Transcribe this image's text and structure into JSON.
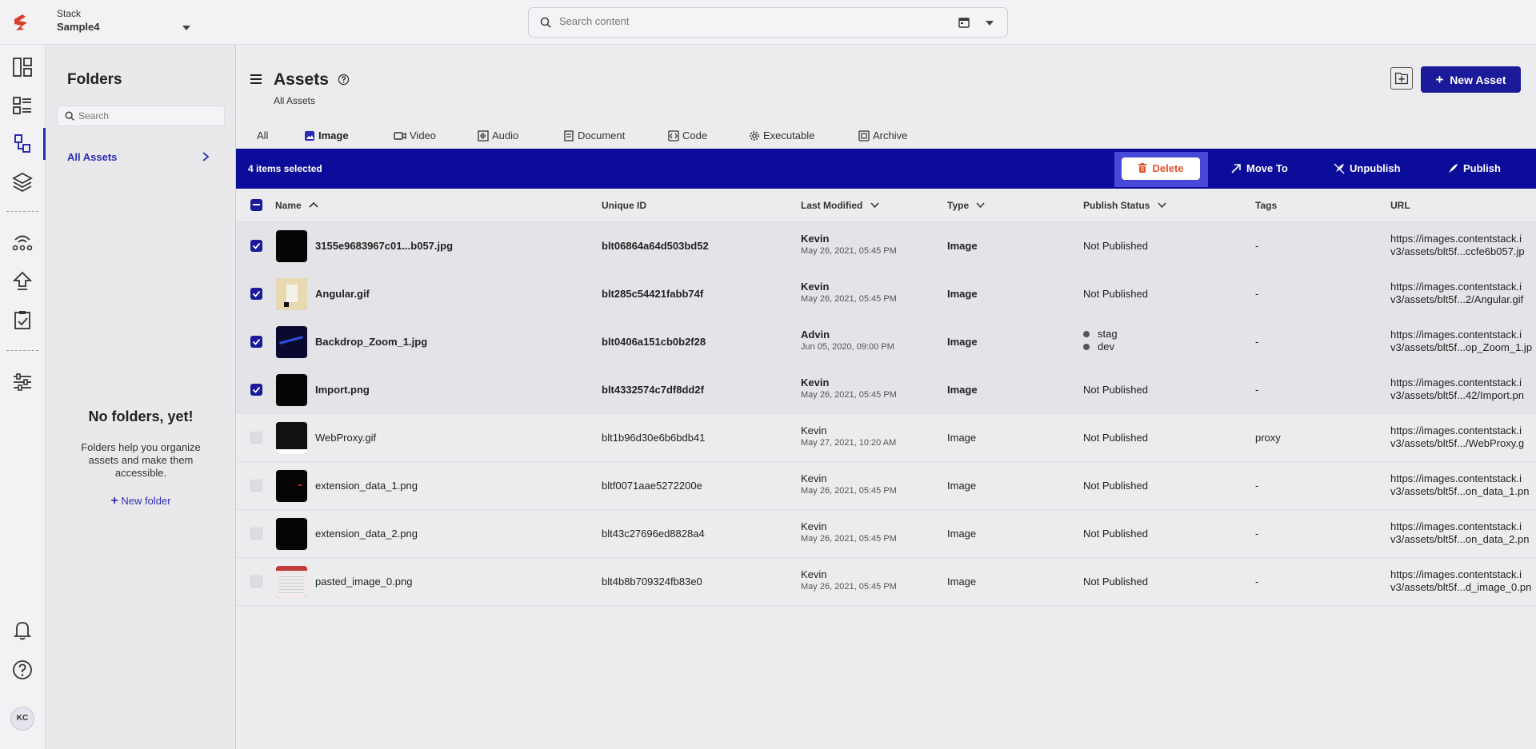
{
  "app": {
    "stack_label": "Stack",
    "stack_name": "Sample4",
    "search_placeholder": "Search content",
    "avatar_initials": "KC"
  },
  "folders": {
    "title": "Folders",
    "search_placeholder": "Search",
    "all_assets": "All Assets",
    "empty_title": "No folders, yet!",
    "empty_desc": "Folders help you organize assets and make them accessible.",
    "new_folder": "New folder"
  },
  "header": {
    "title": "Assets",
    "breadcrumb": "All Assets",
    "new_asset": "New Asset"
  },
  "tabs": [
    {
      "label": "All",
      "icon": "none"
    },
    {
      "label": "Image",
      "icon": "image-icon",
      "active": true
    },
    {
      "label": "Video",
      "icon": "video-icon"
    },
    {
      "label": "Audio",
      "icon": "audio-icon"
    },
    {
      "label": "Document",
      "icon": "document-icon"
    },
    {
      "label": "Code",
      "icon": "code-icon"
    },
    {
      "label": "Executable",
      "icon": "gear-icon"
    },
    {
      "label": "Archive",
      "icon": "archive-icon"
    }
  ],
  "selection_bar": {
    "count": "4 items selected",
    "delete": "Delete",
    "move_to": "Move To",
    "unpublish": "Unpublish",
    "publish": "Publish"
  },
  "columns": {
    "name": "Name",
    "uid": "Unique ID",
    "modified": "Last Modified",
    "type": "Type",
    "status": "Publish Status",
    "tags": "Tags",
    "url": "URL"
  },
  "rows": [
    {
      "name": "3155e9683967c01...b057.jpg",
      "uid": "blt06864a64d503bd52",
      "by": "Kevin",
      "date": "May 26, 2021, 05:45 PM",
      "type": "Image",
      "status": "Not Published",
      "tags": "-",
      "url1": "https://images.contentstack.i",
      "url2": "v3/assets/blt5f...ccfe6b057.jp",
      "selected": true
    },
    {
      "name": "Angular.gif",
      "uid": "blt285c54421fabb74f",
      "by": "Kevin",
      "date": "May 26, 2021, 05:45 PM",
      "type": "Image",
      "status": "Not Published",
      "tags": "-",
      "url1": "https://images.contentstack.i",
      "url2": "v3/assets/blt5f...2/Angular.gif",
      "selected": true
    },
    {
      "name": "Backdrop_Zoom_1.jpg",
      "uid": "blt0406a151cb0b2f28",
      "by": "Advin",
      "date": "Jun 05, 2020, 09:00 PM",
      "type": "Image",
      "status_envs": [
        "stag",
        "dev"
      ],
      "tags": "-",
      "url1": "https://images.contentstack.i",
      "url2": "v3/assets/blt5f...op_Zoom_1.jp",
      "selected": true
    },
    {
      "name": "Import.png",
      "uid": "blt4332574c7df8dd2f",
      "by": "Kevin",
      "date": "May 26, 2021, 05:45 PM",
      "type": "Image",
      "status": "Not Published",
      "tags": "-",
      "url1": "https://images.contentstack.i",
      "url2": "v3/assets/blt5f...42/Import.pn",
      "selected": true
    },
    {
      "name": "WebProxy.gif",
      "uid": "blt1b96d30e6b6bdb41",
      "by": "Kevin",
      "date": "May 27, 2021, 10:20 AM",
      "type": "Image",
      "status": "Not Published",
      "tags": "proxy",
      "url1": "https://images.contentstack.i",
      "url2": "v3/assets/blt5f.../WebProxy.g",
      "selected": false
    },
    {
      "name": "extension_data_1.png",
      "uid": "bltf0071aae5272200e",
      "by": "Kevin",
      "date": "May 26, 2021, 05:45 PM",
      "type": "Image",
      "status": "Not Published",
      "tags": "-",
      "url1": "https://images.contentstack.i",
      "url2": "v3/assets/blt5f...on_data_1.pn",
      "selected": false
    },
    {
      "name": "extension_data_2.png",
      "uid": "blt43c27696ed8828a4",
      "by": "Kevin",
      "date": "May 26, 2021, 05:45 PM",
      "type": "Image",
      "status": "Not Published",
      "tags": "-",
      "url1": "https://images.contentstack.i",
      "url2": "v3/assets/blt5f...on_data_2.pn",
      "selected": false
    },
    {
      "name": "pasted_image_0.png",
      "uid": "blt4b8b709324fb83e0",
      "by": "Kevin",
      "date": "May 26, 2021, 05:45 PM",
      "type": "Image",
      "status": "Not Published",
      "tags": "-",
      "url1": "https://images.contentstack.i",
      "url2": "v3/assets/blt5f...d_image_0.pn",
      "selected": false
    }
  ],
  "colors": {
    "accent": "#1a1a9a",
    "delete": "#e3502b",
    "brand": "#d9402b"
  }
}
